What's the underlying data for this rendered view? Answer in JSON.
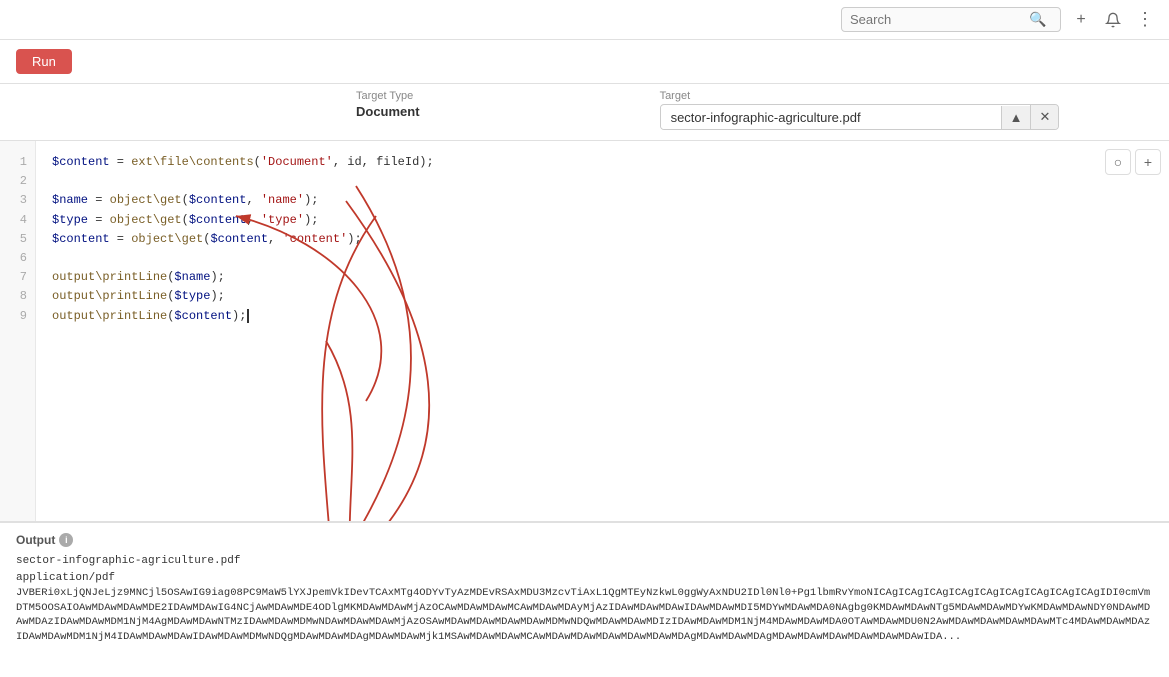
{
  "topbar": {
    "search_placeholder": "Search",
    "add_icon": "+",
    "bell_icon": "🔔",
    "menu_icon": "⋮"
  },
  "toolbar": {
    "run_label": "Run"
  },
  "target_type": {
    "label": "Target Type",
    "value": "Document"
  },
  "target": {
    "label": "Target",
    "value": "sector-infographic-agriculture.pdf",
    "up_btn": "▲",
    "close_btn": "✕"
  },
  "editor": {
    "circle_btn": "○",
    "add_btn": "+",
    "lines": [
      {
        "num": "1",
        "code": "$content = ext\\file\\contents('Document', id, fileId);",
        "tokens": [
          {
            "t": "var",
            "v": "$content"
          },
          {
            "t": "op",
            "v": " = "
          },
          {
            "t": "fn",
            "v": "ext\\file\\contents"
          },
          {
            "t": "plain",
            "v": "("
          },
          {
            "t": "str",
            "v": "'Document'"
          },
          {
            "t": "plain",
            "v": ", id, fileId);"
          }
        ]
      },
      {
        "num": "2",
        "code": ""
      },
      {
        "num": "3",
        "code": "$name = object\\get($content, 'name');",
        "tokens": [
          {
            "t": "var",
            "v": "$name"
          },
          {
            "t": "op",
            "v": " = "
          },
          {
            "t": "fn",
            "v": "object\\get"
          },
          {
            "t": "plain",
            "v": "("
          },
          {
            "t": "var",
            "v": "$content"
          },
          {
            "t": "plain",
            "v": ", "
          },
          {
            "t": "str",
            "v": "'name'"
          },
          {
            "t": "plain",
            "v": ");"
          }
        ]
      },
      {
        "num": "4",
        "code": "$type = object\\get($content, 'type');"
      },
      {
        "num": "5",
        "code": "$content = object\\get($content, 'content');"
      },
      {
        "num": "6",
        "code": ""
      },
      {
        "num": "7",
        "code": "output\\printLine($name);"
      },
      {
        "num": "8",
        "code": "output\\printLine($type);"
      },
      {
        "num": "9",
        "code": "output\\printLine($content);"
      }
    ]
  },
  "output": {
    "label": "Output",
    "lines": [
      "sector-infographic-agriculture.pdf",
      "application/pdf",
      "JVBERi0xLjQNJeLjz9MNCjl5OSAwIG9iag08PC9MaW5lYXJpemVkIDevTCAxMTg4ODYvTyAzMDEvRSAxMDU3MzcvTiAxL1QgMTEyNzkwL0ggWyAxNDU2IDl0Nl0+Pg1lbmRvYmoNICAgICAgICAgICAgICAgICAgICAgICAgICAgIDI0cmVmDTM5OOSAIOAwMDAwMDAwMDE2IDAwMDAwIG4NCjAwMDAwMDE4ODlgMKMDAwMDAwMjAzOCAwMDAwMDAwMCAwMDAwMDAyMjAzIDAwMDAwMDAwIDAwMDAwMDI5MDYwMDAwMDA0NAgbg0KMDAwMDAwNTg5MDAwMDAwMDYwKMDAwMDAwNDY0NDAwMDAwMDAzIDAwMDAwMDM1NjM4AgMDAwMDAwNTMzIDAwMDAwMDMwNDAwMDAwMDAwMjAzOSAwMDAwMDAwMDAwMDAwMDMwNDQwMDAwMDAwMDIzIDAwMDAwMDM1NjM4MDAwMDAwMDA0OTAwMDAwMDU0N..."
    ]
  }
}
